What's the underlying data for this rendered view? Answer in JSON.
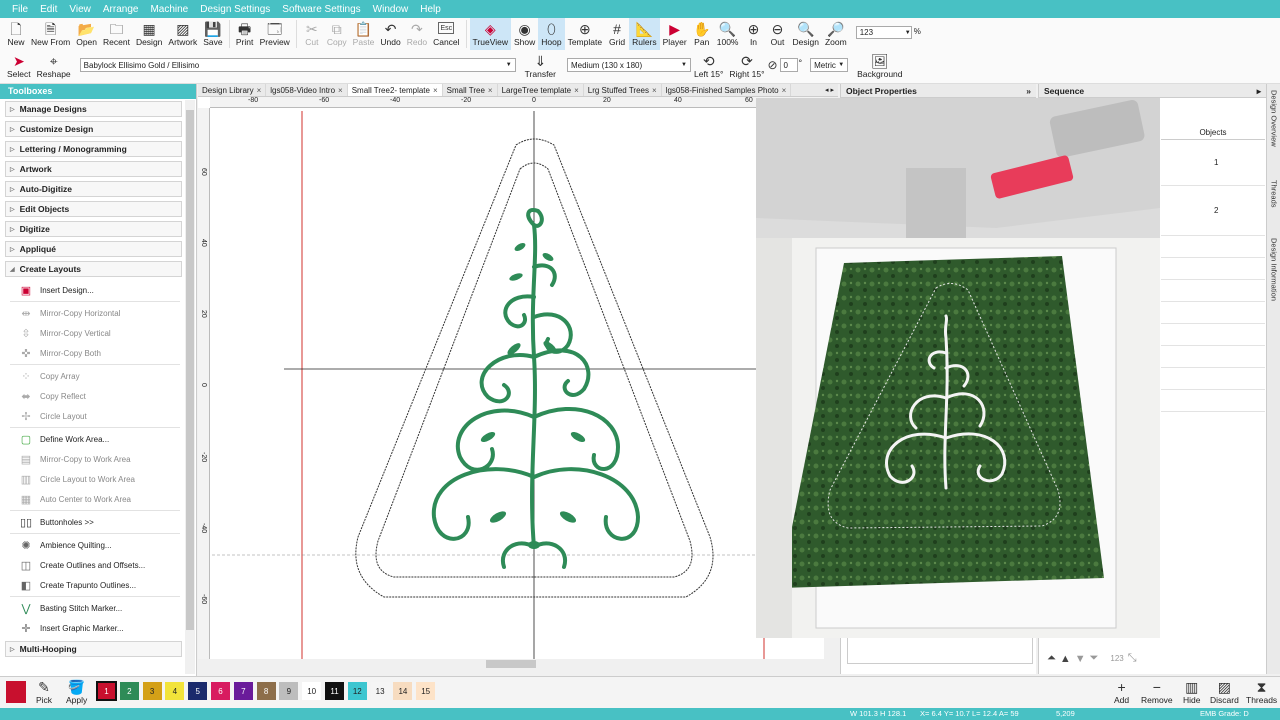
{
  "menubar": [
    "File",
    "Edit",
    "View",
    "Arrange",
    "Machine",
    "Design Settings",
    "Software Settings",
    "Window",
    "Help"
  ],
  "ribbon": {
    "new": "New",
    "new_from": "New From",
    "open": "Open",
    "recent": "Recent",
    "design": "Design",
    "artwork": "Artwork",
    "save": "Save",
    "print": "Print",
    "preview": "Preview",
    "cut": "Cut",
    "copy": "Copy",
    "paste": "Paste",
    "undo": "Undo",
    "redo": "Redo",
    "cancel": "Cancel",
    "esc": "Esc",
    "trueview": "TrueView",
    "show": "Show",
    "hoop": "Hoop",
    "template": "Template",
    "grid": "Grid",
    "rulers": "Rulers",
    "player": "Player",
    "pan": "Pan",
    "zoom100": "100%",
    "in": "In",
    "out": "Out",
    "zoom_design": "Design",
    "zoom": "Zoom",
    "zoom_value": "123",
    "zoom_unit": "%"
  },
  "toolbar2": {
    "select": "Select",
    "reshape": "Reshape",
    "font": "Babylock Ellisimo Gold / Ellisimo",
    "transfer": "Transfer",
    "hoop_size": "Medium (130 x 180)",
    "left15": "Left 15°",
    "right15": "Right 15°",
    "rotate_value": "0",
    "degree": "°",
    "units": "Metric",
    "background": "Background"
  },
  "toolbox": {
    "title": "Toolboxes",
    "sections_top": [
      "Manage Designs",
      "Customize Design",
      "Lettering / Monogramming",
      "Artwork",
      "Auto-Digitize",
      "Edit Objects",
      "Digitize",
      "Appliqué",
      "Create Layouts"
    ],
    "insert_design": "Insert Design...",
    "mirror_h": "Mirror-Copy Horizontal",
    "mirror_v": "Mirror-Copy Vertical",
    "mirror_both": "Mirror-Copy Both",
    "copy_array": "Copy Array",
    "copy_reflect": "Copy Reflect",
    "circle_layout": "Circle Layout",
    "define_work_area": "Define Work Area...",
    "mirror_work": "Mirror-Copy to Work Area",
    "circle_work": "Circle Layout to Work Area",
    "auto_center": "Auto Center to Work Area",
    "buttonholes": "Buttonholes >>",
    "ambience": "Ambience Quilting...",
    "outlines": "Create Outlines and Offsets...",
    "trapunto": "Create Trapunto Outlines...",
    "basting": "Basting Stitch Marker...",
    "insert_graphic": "Insert Graphic Marker...",
    "multi_hooping": "Multi-Hooping"
  },
  "tabs": [
    {
      "label": "Design Library"
    },
    {
      "label": "lgs058-Video Intro"
    },
    {
      "label": "Small Tree2- template"
    },
    {
      "label": "Small Tree"
    },
    {
      "label": "LargeTree template"
    },
    {
      "label": "Lrg Stuffed Trees"
    },
    {
      "label": "lgs058-Finished Samples Photo"
    }
  ],
  "rulers": {
    "h": [
      "-80",
      "-60",
      "-40",
      "-20",
      "0",
      "20",
      "40",
      "60"
    ],
    "v": [
      "60",
      "40",
      "20",
      "0",
      "-20",
      "-40",
      "-60"
    ]
  },
  "panels": {
    "object_properties": "Object Properties",
    "sequence": "Sequence",
    "objects_header": "Objects",
    "rows": [
      "1",
      "2"
    ],
    "side_tabs": [
      "Design Overview",
      "Threads",
      "Design Information"
    ],
    "seq_zoom": "123"
  },
  "colors": {
    "accent": "#48c1c4",
    "embroidery_green": "#2e8b57",
    "swatches": [
      {
        "num": "1",
        "color": "#c8102e",
        "text": "#ffffff"
      },
      {
        "num": "2",
        "color": "#2e8b57",
        "text": "#ffffff"
      },
      {
        "num": "3",
        "color": "#d4a017",
        "text": "#222222"
      },
      {
        "num": "4",
        "color": "#f2e33a",
        "text": "#222222"
      },
      {
        "num": "5",
        "color": "#1a2a6c",
        "text": "#ffffff"
      },
      {
        "num": "6",
        "color": "#d81b60",
        "text": "#ffffff"
      },
      {
        "num": "7",
        "color": "#6a1b9a",
        "text": "#ffffff"
      },
      {
        "num": "8",
        "color": "#8d6e4a",
        "text": "#ffffff"
      },
      {
        "num": "9",
        "color": "#bdbdbd",
        "text": "#222222"
      },
      {
        "num": "10",
        "color": "#ffffff",
        "text": "#222222"
      },
      {
        "num": "11",
        "color": "#111111",
        "text": "#ffffff"
      },
      {
        "num": "12",
        "color": "#3cc6d0",
        "text": "#222222"
      },
      {
        "num": "13",
        "color": "#f5f5f5",
        "text": "#222222"
      },
      {
        "num": "14",
        "color": "#f7dcc0",
        "text": "#222222"
      },
      {
        "num": "15",
        "color": "#fde3c8",
        "text": "#222222"
      }
    ]
  },
  "colorbar": {
    "pick": "Pick",
    "apply": "Apply",
    "add": "Add",
    "remove": "Remove",
    "hide": "Hide",
    "discard": "Discard",
    "threads": "Threads"
  },
  "status": {
    "size": "W 101.3 H 128.1",
    "coords": "X=  6.4 Y=  10.7 L=  12.4 A=  59",
    "stitches": "5,209",
    "grade": "EMB Grade: D"
  }
}
